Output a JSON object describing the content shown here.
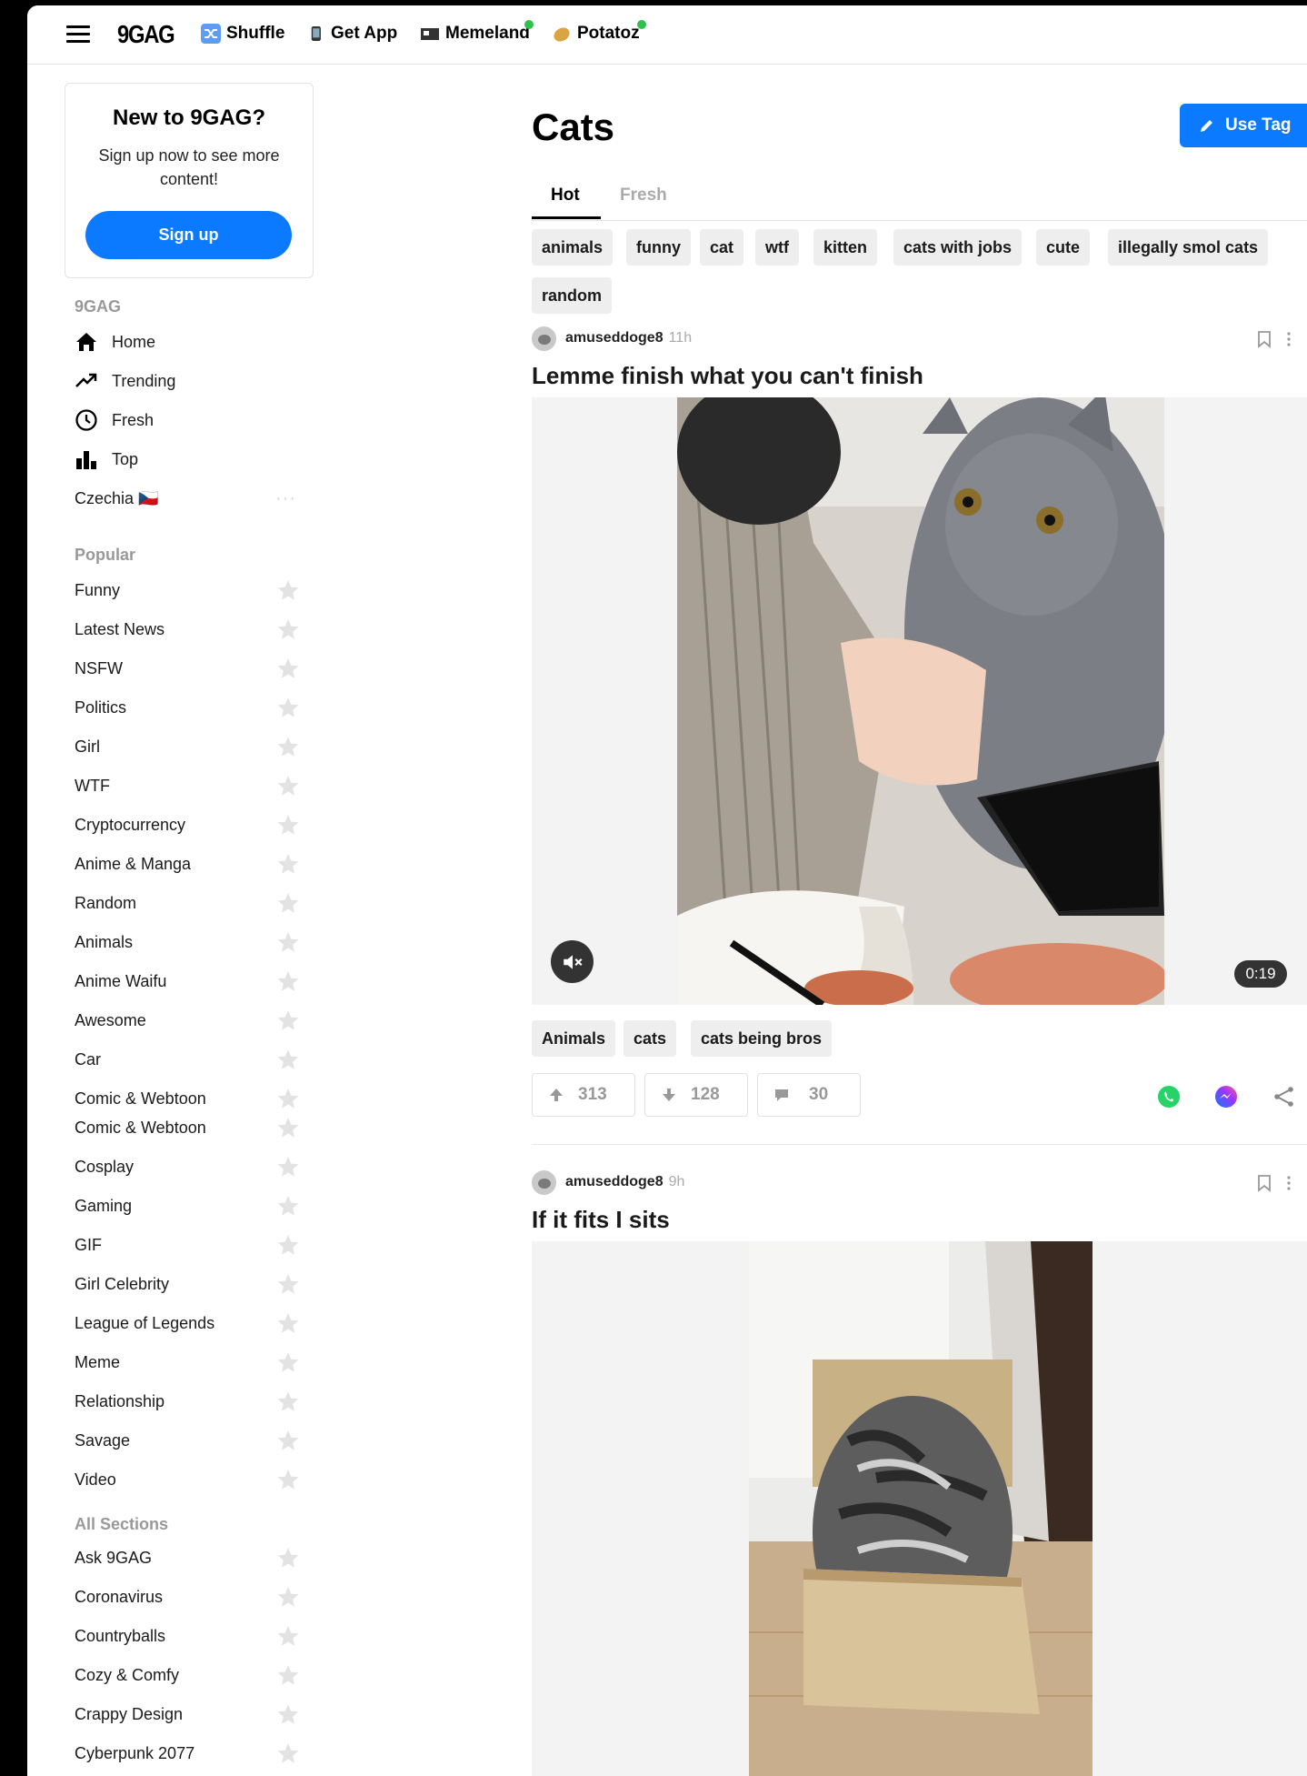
{
  "topbar": {
    "logo": "9GAG",
    "nav": [
      {
        "label": "Shuffle",
        "icon": "shuffle-icon"
      },
      {
        "label": "Get App",
        "icon": "phone-icon"
      },
      {
        "label": "Memeland",
        "icon": "memeland-icon"
      },
      {
        "label": "Potatoz",
        "icon": "potato-icon"
      }
    ]
  },
  "signup_card": {
    "title": "New to 9GAG?",
    "subtitle": "Sign up now to see more content!",
    "button": "Sign up"
  },
  "sidebar": {
    "section_9gag": "9GAG",
    "main_nav": [
      {
        "label": "Home",
        "icon": "home-icon"
      },
      {
        "label": "Trending",
        "icon": "trending-icon"
      },
      {
        "label": "Fresh",
        "icon": "clock-icon"
      },
      {
        "label": "Top",
        "icon": "bar-chart-icon"
      },
      {
        "label": "Czechia 🇨🇿",
        "icon": ""
      }
    ],
    "section_popular": "Popular",
    "popular": [
      "Funny",
      "Latest News",
      "NSFW",
      "Politics",
      "Girl",
      "WTF",
      "Cryptocurrency",
      "Anime & Manga",
      "Random",
      "Animals",
      "Anime Waifu",
      "Awesome",
      "Car",
      "Comic & Webtoon",
      "Comic & Webtoon",
      "Cosplay",
      "Gaming",
      "GIF",
      "Girl Celebrity",
      "League of Legends",
      "Meme",
      "Relationship",
      "Savage",
      "Video"
    ],
    "section_all": "All Sections",
    "all_sections": [
      "Ask 9GAG",
      "Coronavirus",
      "Countryballs",
      "Cozy & Comfy",
      "Crappy Design",
      "Cyberpunk 2077"
    ]
  },
  "main": {
    "title": "Cats",
    "use_tag": "Use Tag",
    "tabs": [
      "Hot",
      "Fresh"
    ],
    "tags": [
      "animals",
      "funny",
      "cat",
      "wtf",
      "kitten",
      "cats with jobs",
      "cute",
      "illegally smol cats",
      "random"
    ]
  },
  "posts": [
    {
      "username": "amuseddoge8",
      "time": "11h",
      "title": "Lemme finish what you can't finish",
      "duration": "0:19",
      "tags": [
        "Animals",
        "cats",
        "cats being bros"
      ],
      "upvotes": "313",
      "downvotes": "128",
      "comments": "30"
    },
    {
      "username": "amuseddoge8",
      "time": "9h",
      "title": "If it fits I sits"
    }
  ],
  "colors": {
    "accent": "#0b7aff",
    "whatsapp": "#25d366",
    "messenger": "#8a3ffc",
    "status_dot": "#2fc24b"
  }
}
